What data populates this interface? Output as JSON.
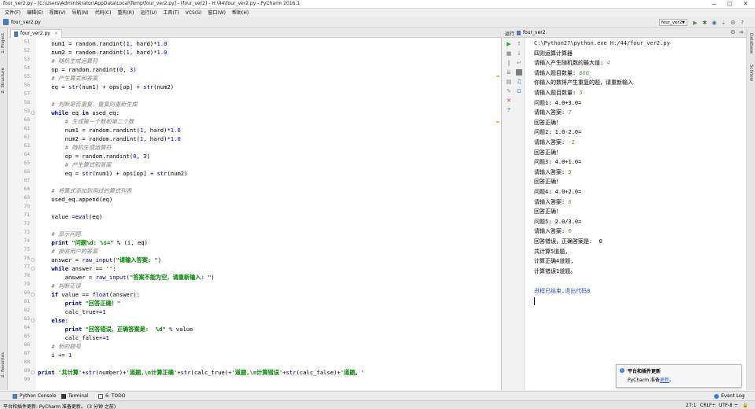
{
  "window": {
    "title": "four_ver2.py - [C:\\Users\\Administrator\\AppData\\Local\\Temp\\four_ver2.py] - [four_ver2] - H:\\44\\four_ver2.py - PyCharm 2016.1",
    "minimize": "—",
    "maximize": "□",
    "close": "✕"
  },
  "menu": [
    "文件(F)",
    "编辑(E)",
    "视图(V)",
    "导航(N)",
    "代码(C)",
    "重构(R)",
    "运行(U)",
    "工具(T)",
    "VCS(S)",
    "窗口(W)",
    "帮助(H)"
  ],
  "nav": {
    "breadcrumb": "four_ver2.py",
    "run_config": "four_ver2"
  },
  "left_tabs": [
    "1: Project",
    "2: Structure",
    "2: Favorites"
  ],
  "right_tabs": [
    "Database",
    "SciView"
  ],
  "editor": {
    "tab_label": "four_ver2.py",
    "tab_close": "×",
    "lines": [
      {
        "n": "51",
        "html": "    num1 = random.randint(<span class='num'>1</span>, hard)*<span class='num'>1.0</span>"
      },
      {
        "n": "52",
        "html": "    num2 = random.randint(<span class='num'>1</span>, hard)*<span class='num'>1.0</span>"
      },
      {
        "n": "53",
        "html": "    <span class='cm'># 随机生成运算符</span>"
      },
      {
        "n": "54",
        "html": "    op = random.randint(<span class='num'>0</span>, <span class='num'>3</span>)"
      },
      {
        "n": "55",
        "html": "    <span class='cm'># 产生算式和答案</span>"
      },
      {
        "n": "56",
        "html": "    eq = <span class='bi'>str</span>(num1) + ops[op] + <span class='bi'>str</span>(num2)"
      },
      {
        "n": "57",
        "html": ""
      },
      {
        "n": "58",
        "html": "    <span class='cm'># 判断是否重复，重复则重新生成</span>"
      },
      {
        "n": "59",
        "html": "    <span class='kw'>while</span> eq <span class='kw'>in</span> used_eq:"
      },
      {
        "n": "60",
        "html": "        <span class='cm'># 生成第一个数和第二个数</span>"
      },
      {
        "n": "61",
        "html": "        num1 = random.randint(<span class='num'>1</span>, hard)*<span class='num'>1.0</span>"
      },
      {
        "n": "62",
        "html": "        num2 = random.randint(<span class='num'>1</span>, hard)*<span class='num'>1.0</span>"
      },
      {
        "n": "63",
        "html": "        <span class='cm'># 随机生成运算符</span>"
      },
      {
        "n": "64",
        "html": "        op = random.randint(<span class='num'>0</span>, <span class='num'>3</span>)"
      },
      {
        "n": "65",
        "html": "        <span class='cm'># 产生算式和答案</span>"
      },
      {
        "n": "66",
        "html": "        eq = <span class='bi'>str</span>(num1) + ops[op] + <span class='bi'>str</span>(num2)"
      },
      {
        "n": "67",
        "html": ""
      },
      {
        "n": "68",
        "html": "    <span class='cm'># 将算式添加到用过的算式列表</span>"
      },
      {
        "n": "69",
        "html": "    used_eq.append(eq)"
      },
      {
        "n": "70",
        "html": ""
      },
      {
        "n": "71",
        "html": "    value =<span class='bi'>eval</span>(eq)"
      },
      {
        "n": "72",
        "html": ""
      },
      {
        "n": "73",
        "html": "    <span class='cm'># 显示问题</span>"
      },
      {
        "n": "74",
        "html": "    <span class='kw'>print</span> <span class='str'>\"问题%d: %s=\"</span> % (i, eq)"
      },
      {
        "n": "75",
        "html": "    <span class='cm'># 接收用户的答案</span>"
      },
      {
        "n": "76",
        "html": "    answer = <span class='bi'>raw_input</span>(<span class='str'>\"请输入答案: \"</span>)"
      },
      {
        "n": "77",
        "html": "    <span class='kw'>while</span> answer == <span class='str'>''</span>:"
      },
      {
        "n": "78",
        "html": "        answer = <span class='bi'>raw_input</span>(<span class='str'>\"答案不能为空，请重新输入: \"</span>)"
      },
      {
        "n": "79",
        "html": "    <span class='cm'># 判断正误</span>"
      },
      {
        "n": "80",
        "html": "    <span class='kw'>if</span> value == <span class='bi'>float</span>(answer):"
      },
      {
        "n": "81",
        "html": "        <span class='kw'>print</span> <span class='str'>\"回答正确！\"</span>"
      },
      {
        "n": "82",
        "html": "        calc_true+=<span class='num'>1</span>"
      },
      {
        "n": "83",
        "html": "    <span class='kw'>else</span>:"
      },
      {
        "n": "84",
        "html": "        <span class='kw'>print</span> <span class='str'>\"回答错误，正确答案是:  %d\"</span> % value"
      },
      {
        "n": "85",
        "html": "        calc_false+=<span class='num'>1</span>"
      },
      {
        "n": "86",
        "html": "    <span class='cm'># 新的题号</span>"
      },
      {
        "n": "87",
        "html": "    i += <span class='num'>1</span>"
      },
      {
        "n": "88",
        "html": ""
      },
      {
        "n": "89",
        "html": "<span class='kw'>print</span> <span class='str'>'共计算'</span>+<span class='bi'>str</span>(number)+<span class='str'>'道题,\\n计算正确'</span>+<span class='bi'>str</span>(calc_true)+<span class='str'>'道题,\\n计算错误'</span>+<span class='bi'>str</span>(calc_false)+<span class='str'>'道题。'</span>"
      },
      {
        "n": "90",
        "html": ""
      }
    ]
  },
  "run": {
    "label": "运行",
    "config": "four_ver2",
    "output": [
      {
        "text": "C:\\Python27\\python.exe H:/44/four_ver2.py",
        "cls": "path"
      },
      {
        "text": "四则运算计算器",
        "cls": ""
      },
      {
        "text": "请输入产生随机数的最大值: ",
        "input": "4"
      },
      {
        "text": "请输入题目数量: ",
        "input": "666"
      },
      {
        "text": "你输入的数将产生重复的题，请重新输入",
        "cls": ""
      },
      {
        "text": "请输入题目数量: ",
        "input": "5"
      },
      {
        "text": "问题1: 4.0+3.0=",
        "cls": ""
      },
      {
        "text": "请输入答案: ",
        "input": "7"
      },
      {
        "text": "回答正确！",
        "cls": ""
      },
      {
        "text": "问题2: 1.0-2.0=",
        "cls": ""
      },
      {
        "text": "请输入答案: ",
        "input": "-1"
      },
      {
        "text": "回答正确！",
        "cls": ""
      },
      {
        "text": "问题3: 4.0+1.0=",
        "cls": ""
      },
      {
        "text": "请输入答案: ",
        "input": "5"
      },
      {
        "text": "回答正确！",
        "cls": ""
      },
      {
        "text": "问题4: 4.0+2.0=",
        "cls": ""
      },
      {
        "text": "请输入答案: ",
        "input": "6"
      },
      {
        "text": "回答正确！",
        "cls": ""
      },
      {
        "text": "问题5: 2.0/3.0=",
        "cls": ""
      },
      {
        "text": "请输入答案: ",
        "input": "0"
      },
      {
        "text": "回答错误，正确答案是:  0",
        "cls": ""
      },
      {
        "text": "共计算5道题,",
        "cls": ""
      },
      {
        "text": "计算正确4道题,",
        "cls": ""
      },
      {
        "text": "计算错误1道题。",
        "cls": ""
      },
      {
        "text": "",
        "cls": ""
      },
      {
        "text": "进程已结束,退出代码0",
        "cls": "done"
      }
    ]
  },
  "notification": {
    "title": "平台和插件更新",
    "body": "PyCharm 准备",
    "link": "更新",
    "suffix": "。"
  },
  "toolwindows": {
    "python_console": "Python Console",
    "terminal": "Terminal",
    "todo": "6: TODO",
    "event_log": "Event Log"
  },
  "status": {
    "message": "平台和插件更新: PyCharm 准备更新。 (3 分钟 之前)",
    "position": "27:1",
    "line_sep": "CRLF÷",
    "encoding": "UTF-8 ÷"
  },
  "colors": {
    "keyword": "#000080",
    "string": "#008000",
    "comment": "#808080",
    "number": "#0000ff",
    "user_input": "#5a9b41",
    "exit_message": "#2c4fbf"
  }
}
